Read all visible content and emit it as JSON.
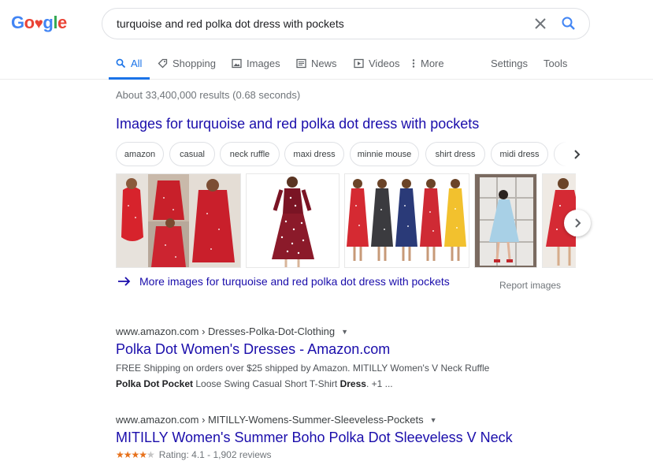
{
  "logo": {
    "text": "Google"
  },
  "search": {
    "query": "turquoise and red polka dot dress with pockets"
  },
  "tabs": {
    "all": "All",
    "shopping": "Shopping",
    "images": "Images",
    "news": "News",
    "videos": "Videos",
    "more": "More",
    "settings": "Settings",
    "tools": "Tools"
  },
  "stats": "About 33,400,000 results (0.68 seconds)",
  "image_pack": {
    "heading": "Images for turquoise and red polka dot dress with pockets",
    "chips": [
      "amazon",
      "casual",
      "neck ruffle",
      "maxi dress",
      "minnie mouse",
      "shirt dress",
      "midi dress"
    ],
    "more_link": "More images for turquoise and red polka dot dress with pockets",
    "report": "Report images"
  },
  "results": [
    {
      "cite": "www.amazon.com › Dresses-Polka-Dot-Clothing",
      "title": "Polka Dot Women's Dresses - Amazon.com",
      "snippet_line1": "FREE Shipping on orders over $25 shipped by Amazon. MITILLY Women's V Neck Ruffle",
      "snippet_b1": "Polka Dot Pocket",
      "snippet_t1": " Loose Swing Casual Short T-Shirt ",
      "snippet_b2": "Dress",
      "snippet_t2": ". +1 ..."
    },
    {
      "cite": "www.amazon.com › MITILLY-Womens-Summer-Sleeveless-Pockets",
      "title": "MITILLY Women's Summer Boho Polka Dot Sleeveless V Neck",
      "rating_text": "Rating: 4.1 - 1,902 reviews",
      "rating_value": 4.1
    }
  ],
  "colors": {
    "link": "#1a0dab",
    "accent": "#1a73e8",
    "star": "#e7711b"
  },
  "icons": [
    "clear-icon",
    "search-icon",
    "shopping-tag-icon",
    "image-icon",
    "news-icon",
    "video-icon",
    "more-dots-icon",
    "chevron-right-icon",
    "arrow-right-icon",
    "caret-down-icon"
  ]
}
